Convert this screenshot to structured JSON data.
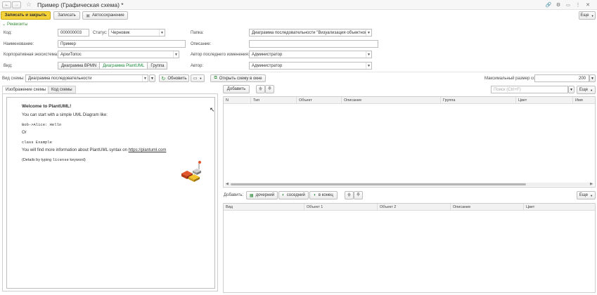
{
  "window": {
    "title": "Пример (Графическая схема) *"
  },
  "toolbar": {
    "save_close": "Записать и закрыть",
    "save": "Записать",
    "autosave": "Автосохранение",
    "more": "Еще"
  },
  "requisites": {
    "label": "Реквизиты"
  },
  "form": {
    "code_label": "Код:",
    "code_value": "000000003",
    "status_label": "Статус:",
    "status_value": "Черновик",
    "folder_label": "Папка:",
    "folder_value": "Диаграмма последовательности \"Визуализация объектной м",
    "name_label": "Наименование:",
    "name_value": "Пример",
    "desc_label": "Описание:",
    "desc_value": "",
    "eco_label": "Корпоративная экосистема:",
    "eco_value": "АрхиТопос",
    "last_author_label": "Автор последнего изменения:",
    "last_author_value": "Администратор",
    "view_label": "Вид:",
    "view_options": [
      "Диаграмма BPMN",
      "Диаграмма PlantUML",
      "Группа"
    ],
    "author_label": "Автор:",
    "author_value": "Администратор"
  },
  "scheme": {
    "type_label": "Вид схемы:",
    "type_value": "Диаграмма последовательности",
    "refresh": "Обновить",
    "open_window": "Открыть схему в окне",
    "max_size_label": "Максимальный размер сообщения:",
    "max_size_value": "200"
  },
  "tabs": [
    "Изображение схемы",
    "Код схемы"
  ],
  "preview": {
    "welcome": "Welcome to PlantUML!",
    "line1": "You can start with a simple UML Diagram like:",
    "code1": "Bob->Alice: Hello",
    "or": "Or",
    "code2": "class Example",
    "more_info_prefix": "You will find more information about PlantUML syntax on ",
    "more_info_link": "https://plantuml.com",
    "details_prefix": "(Details by typing ",
    "details_code": "license",
    "details_suffix": " keyword)"
  },
  "right_top": {
    "add": "Добавить",
    "search_placeholder": "Поиск (Ctrl+F)",
    "more": "Еще",
    "columns": [
      "N",
      "Тип",
      "Объект",
      "Описание",
      "Группа",
      "Цвет",
      "Имя"
    ]
  },
  "right_bottom": {
    "add_label": "Добавить:",
    "child": "дочерний",
    "neighbor": "соседний",
    "end": "в конец",
    "more": "Еще",
    "columns": [
      "Вид",
      "Объект 1",
      "Объект 2",
      "Описание",
      "Цвет"
    ]
  }
}
